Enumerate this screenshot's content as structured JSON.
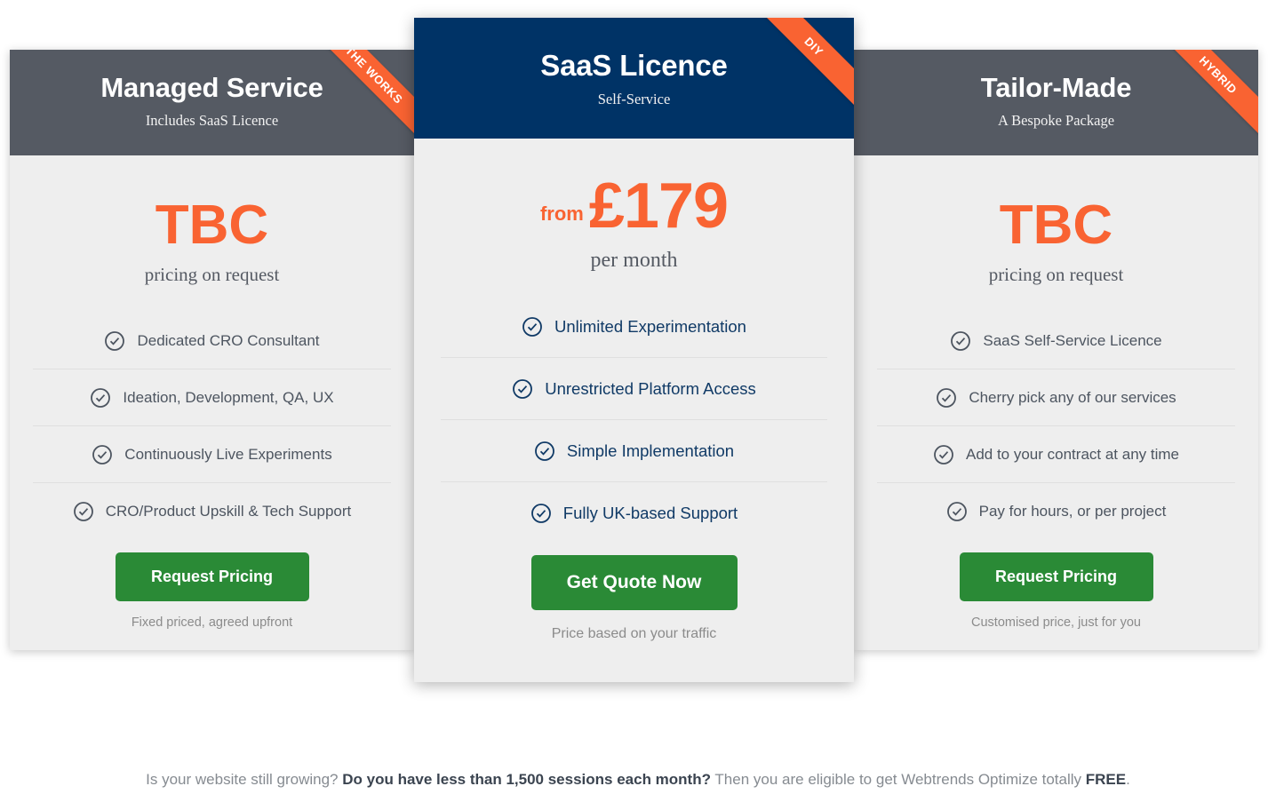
{
  "plans": [
    {
      "id": "managed-service",
      "title": "Managed Service",
      "subtitle": "Includes SaaS Licence",
      "ribbon": "THE WORKS",
      "price": "TBC",
      "price_note": "pricing on request",
      "features": [
        "Dedicated CRO Consultant",
        "Ideation, Development, QA, UX",
        "Continuously Live Experiments",
        "CRO/Product Upskill & Tech Support"
      ],
      "cta_label": "Request Pricing",
      "cta_note": "Fixed priced, agreed upfront"
    },
    {
      "id": "saas-licence",
      "title": "SaaS Licence",
      "subtitle": "Self-Service",
      "ribbon": "DIY",
      "price_from": "from",
      "price_amount": "£179",
      "price_note": "per month",
      "features": [
        "Unlimited Experimentation",
        "Unrestricted Platform Access",
        "Simple Implementation",
        "Fully UK-based Support"
      ],
      "cta_label": "Get Quote Now",
      "cta_note": "Price based on your traffic"
    },
    {
      "id": "tailor-made",
      "title": "Tailor-Made",
      "subtitle": "A Bespoke Package",
      "ribbon": "HYBRID",
      "price": "TBC",
      "price_note": "pricing on request",
      "features": [
        "SaaS Self-Service Licence",
        "Cherry pick any of our services",
        "Add to your contract at any time",
        "Pay for hours, or per project"
      ],
      "cta_label": "Request Pricing",
      "cta_note": "Customised price, just for you"
    }
  ],
  "footer": {
    "part1": "Is your website still growing? ",
    "bold1": "Do you have less than 1,500 sessions each month?",
    "part2": " Then you are eligible to get Webtrends Optimize totally ",
    "bold2": "FREE",
    "part3": "."
  },
  "icons": {
    "check": "check-circle-icon"
  },
  "colors": {
    "header_gray": "#555a63",
    "header_navy": "#003366",
    "accent_orange": "#f96332",
    "cta_green": "#2a8a36",
    "card_bg": "#eeeeee"
  }
}
